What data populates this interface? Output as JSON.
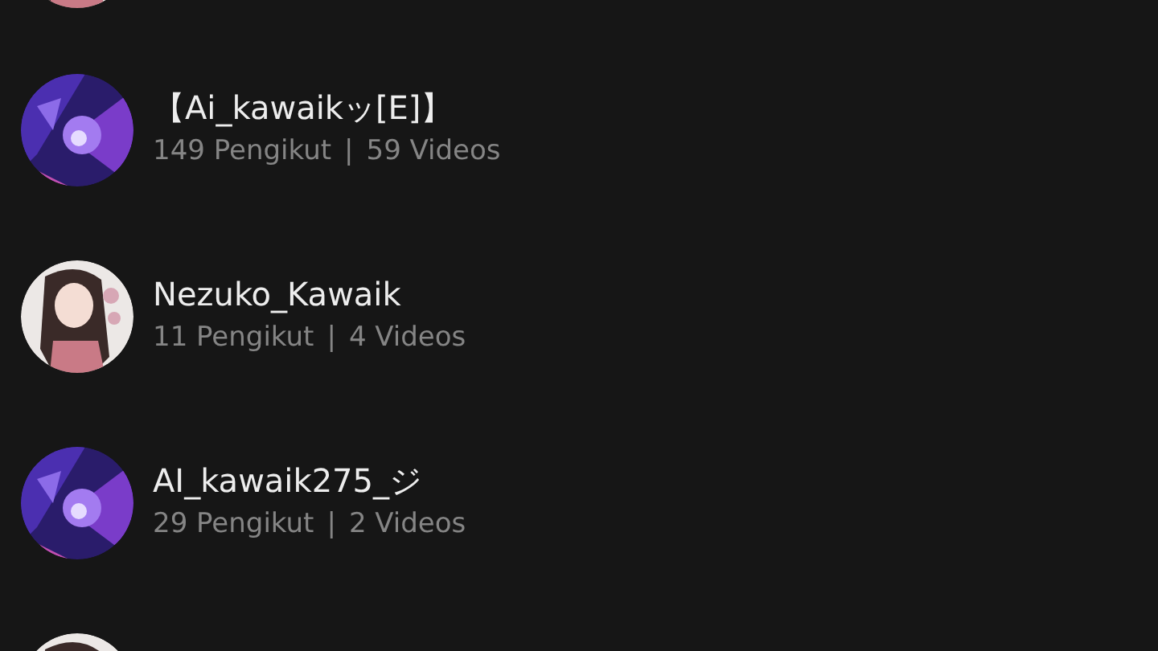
{
  "accounts": [
    {
      "kind": "light"
    },
    {
      "kind": "dark",
      "name": "【Ai_kawaikッ[E]】",
      "followers": "149 Pengikut",
      "separator": "|",
      "videos": "59 Videos"
    },
    {
      "kind": "light",
      "name": "Nezuko_Kawaik",
      "followers": "11 Pengikut",
      "separator": "|",
      "videos": "4 Videos"
    },
    {
      "kind": "dark",
      "name": "AI_kawaik275_ジ",
      "followers": "29 Pengikut",
      "separator": "|",
      "videos": "2 Videos"
    },
    {
      "kind": "light"
    }
  ]
}
